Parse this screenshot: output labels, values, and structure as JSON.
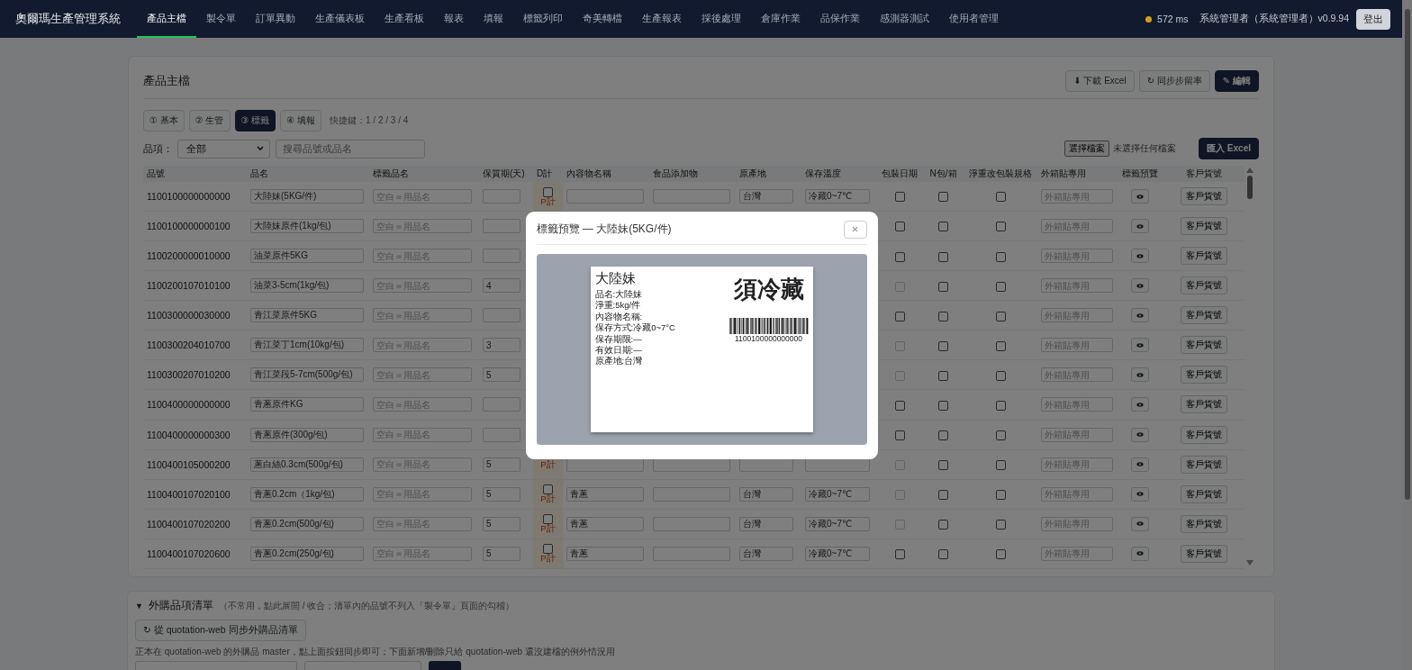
{
  "app": {
    "title": "奧爾瑪生產管理系統"
  },
  "nav": [
    {
      "label": "產品主檔",
      "selected": true
    },
    {
      "label": "製令單",
      "selected": false
    },
    {
      "label": "訂單異動",
      "selected": false
    },
    {
      "label": "生產儀表板",
      "selected": false
    },
    {
      "label": "生產看板",
      "selected": false
    },
    {
      "label": "報表",
      "selected": false
    },
    {
      "label": "填報",
      "selected": false
    },
    {
      "label": "標籤列印",
      "selected": false
    },
    {
      "label": "奇美轉檔",
      "selected": false
    },
    {
      "label": "生產報表",
      "selected": false
    },
    {
      "label": "採後處理",
      "selected": false
    },
    {
      "label": "倉庫作業",
      "selected": false
    },
    {
      "label": "品保作業",
      "selected": false
    },
    {
      "label": "感測器測試",
      "selected": false
    },
    {
      "label": "使用者管理",
      "selected": false
    }
  ],
  "status": {
    "color": "#d4a017",
    "latency": "572 ms",
    "user": "系統管理者（系統管理者）v0.9.94",
    "logout": "登出"
  },
  "page": {
    "title": "產品主檔",
    "actions": [
      {
        "label": "⬇ 下載 Excel",
        "primary": false
      },
      {
        "label": "↻ 同步步留率",
        "primary": false
      },
      {
        "label": "✎ 編輯",
        "primary": true
      }
    ]
  },
  "tabs": [
    {
      "label": "① 基本",
      "selected": false
    },
    {
      "label": "② 生管",
      "selected": false
    },
    {
      "label": "③ 標籤",
      "selected": true
    },
    {
      "label": "④ 填報",
      "selected": false
    }
  ],
  "shortcut_hint": "快捷鍵：1 / 2 / 3 / 4",
  "filter": {
    "label": "品項：",
    "category": "全部",
    "search_placeholder": "搜尋品號或品名"
  },
  "import": {
    "file_button": "選擇檔案",
    "file_status": "未選擇任何檔案",
    "button": "匯入 Excel"
  },
  "table": {
    "columns": [
      "品號",
      "品名",
      "標籤品名",
      "保質期(天)",
      "D計",
      "內容物名稱",
      "食品添加物",
      "原產地",
      "保存溫度",
      "包裝日期",
      "N包/箱",
      "淨重改包裝規格",
      "外箱貼專用",
      "標籤預覽",
      "客戶貨號"
    ],
    "rows": [
      {
        "code": "1100100000000000",
        "name": "大陸妹(5KG/件)",
        "label_placeholder": "空白＝用品名",
        "d_check": {
          "checked": false,
          "note": "P計"
        },
        "origin": "台灣",
        "storage": "冷藏0~7℃",
        "pack_date": {
          "checked": false,
          "disabled": false
        },
        "n_per_box": {
          "checked": false
        },
        "weight_spec": {
          "checked": false
        },
        "outer_placeholder": "外箱貼專用",
        "customer_button": "客戶貨號"
      },
      {
        "code": "1100100000000100",
        "name": "大陸妹原件(1kg/包)",
        "label_placeholder": "空白＝用品名",
        "pack_date": {
          "checked": false,
          "disabled": false
        },
        "n_per_box": {
          "checked": false
        },
        "weight_spec": {
          "checked": false
        },
        "outer_placeholder": "外箱貼專用",
        "customer_button": "客戶貨號"
      },
      {
        "code": "1100200000010000",
        "name": "油菜原件5KG",
        "label_placeholder": "空白＝用品名",
        "pack_date": {
          "checked": false,
          "disabled": false
        },
        "n_per_box": {
          "checked": false
        },
        "weight_spec": {
          "checked": false
        },
        "outer_placeholder": "外箱貼專用",
        "customer_button": "客戶貨號"
      },
      {
        "code": "1100200107010100",
        "name": "油菜3-5cm(1kg/包)",
        "label_placeholder": "空白＝用品名",
        "shelf_life": "4",
        "pack_date": {
          "checked": false,
          "disabled": true
        },
        "n_per_box": {
          "checked": false
        },
        "weight_spec": {
          "checked": false
        },
        "outer_placeholder": "外箱貼專用",
        "customer_button": "客戶貨號"
      },
      {
        "code": "1100300000030000",
        "name": "青江菜原件5KG",
        "label_placeholder": "空白＝用品名",
        "pack_date": {
          "checked": false,
          "disabled": false
        },
        "n_per_box": {
          "checked": false
        },
        "weight_spec": {
          "checked": false
        },
        "outer_placeholder": "外箱貼專用",
        "customer_button": "客戶貨號"
      },
      {
        "code": "1100300204010700",
        "name": "青江菜丁1cm(10kg/包)",
        "label_placeholder": "空白＝用品名",
        "shelf_life": "3",
        "pack_date": {
          "checked": false,
          "disabled": true
        },
        "n_per_box": {
          "checked": false
        },
        "weight_spec": {
          "checked": false
        },
        "outer_placeholder": "外箱貼專用",
        "customer_button": "客戶貨號"
      },
      {
        "code": "1100300207010200",
        "name": "青江菜段5-7cm(500g/包)",
        "label_placeholder": "空白＝用品名",
        "shelf_life": "5",
        "pack_date": {
          "checked": false,
          "disabled": true
        },
        "n_per_box": {
          "checked": false
        },
        "weight_spec": {
          "checked": false
        },
        "outer_placeholder": "外箱貼專用",
        "customer_button": "客戶貨號"
      },
      {
        "code": "1100400000000000",
        "name": "青蔥原件KG",
        "label_placeholder": "空白＝用品名",
        "pack_date": {
          "checked": false,
          "disabled": false
        },
        "n_per_box": {
          "checked": false
        },
        "weight_spec": {
          "checked": false
        },
        "outer_placeholder": "外箱貼專用",
        "customer_button": "客戶貨號"
      },
      {
        "code": "1100400000000300",
        "name": "青蔥原件(300g/包)",
        "label_placeholder": "空白＝用品名",
        "pack_date": {
          "checked": false,
          "disabled": false
        },
        "n_per_box": {
          "checked": false
        },
        "weight_spec": {
          "checked": false
        },
        "outer_placeholder": "外箱貼專用",
        "customer_button": "客戶貨號"
      },
      {
        "code": "1100400105000200",
        "name": "蔥白絲0.3cm(500g/包)",
        "label_placeholder": "空白＝用品名",
        "shelf_life": "5",
        "d_check": {
          "note": "P計"
        },
        "pack_date": {
          "checked": false,
          "disabled": true
        },
        "n_per_box": {
          "checked": false
        },
        "weight_spec": {
          "checked": false
        },
        "outer_placeholder": "外箱貼專用",
        "customer_button": "客戶貨號"
      },
      {
        "code": "1100400107020100",
        "name": "青蔥0.2cm（1kg/包)",
        "label_placeholder": "空白＝用品名",
        "shelf_life": "5",
        "d_check": {
          "checked": false,
          "note": "P計"
        },
        "contents": "青蔥",
        "origin": "台灣",
        "storage": "冷藏0~7℃",
        "pack_date": {
          "checked": false,
          "disabled": true
        },
        "n_per_box": {
          "checked": false
        },
        "weight_spec": {
          "checked": false
        },
        "outer_placeholder": "外箱貼專用",
        "customer_button": "客戶貨號"
      },
      {
        "code": "1100400107020200",
        "name": "青蔥0.2cm(500g/包)",
        "label_placeholder": "空白＝用品名",
        "shelf_life": "5",
        "d_check": {
          "checked": false,
          "note": "P計"
        },
        "contents": "青蔥",
        "origin": "台灣",
        "storage": "冷藏0~7℃",
        "pack_date": {
          "checked": false,
          "disabled": true
        },
        "n_per_box": {
          "checked": false
        },
        "weight_spec": {
          "checked": false
        },
        "outer_placeholder": "外箱貼專用",
        "customer_button": "客戶貨號"
      },
      {
        "code": "1100400107020600",
        "name": "青蔥0.2cm(250g/包)",
        "label_placeholder": "空白＝用品名",
        "shelf_life": "5",
        "d_check": {
          "checked": false,
          "note": "P計"
        },
        "contents": "青蔥",
        "origin": "台灣",
        "storage": "冷藏0~7℃",
        "pack_date": {
          "checked": false,
          "disabled": false
        },
        "n_per_box": {
          "checked": false
        },
        "weight_spec": {
          "checked": false
        },
        "outer_placeholder": "外箱貼專用",
        "customer_button": "客戶貨號"
      }
    ]
  },
  "purchase": {
    "toggle": "▼",
    "title": "外購品項清單",
    "hint": "（不常用，點此展開 / 收合；清單內的品號不列入「製令單」頁面的勾稽）",
    "sync_button": "↻ 從 quotation-web 同步外購品清單",
    "note": "正本在 quotation-web 的外購品 master，點上面按鈕同步即可；下面新增/刪除只給 quotation-web 還沒建檔的例外情況用"
  },
  "modal": {
    "title": "標籤預覽 — 大陸妹(5KG/件)",
    "close": "×",
    "label": {
      "name": "大陸妹",
      "groups": [
        [
          "品名:大陸妹",
          "淨重:5kg/件"
        ],
        [
          "內容物名稱:",
          "保存方式:冷藏0~7°C"
        ],
        [
          "保存期限:—",
          "有效日期:—",
          "原產地:台灣"
        ]
      ],
      "warning": "須冷藏",
      "barcode_text": "1100100000000000"
    }
  }
}
